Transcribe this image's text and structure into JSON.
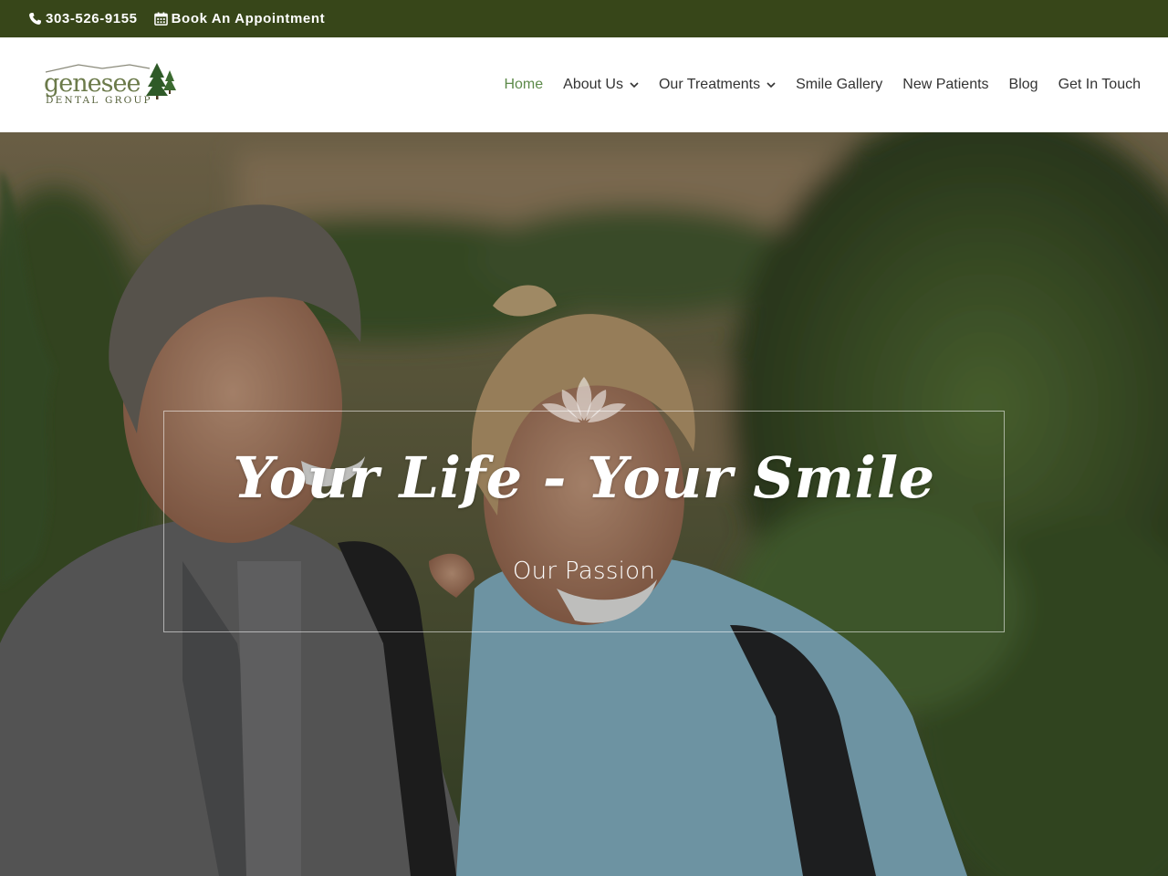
{
  "topbar": {
    "phone": "303-526-9155",
    "phone_icon": "phone-icon",
    "appointment": "Book An Appointment",
    "appointment_icon": "calendar-icon",
    "bg_color": "#374619"
  },
  "header": {
    "logo_alt": "Genesee Dental Group",
    "nav": [
      {
        "label": "Home",
        "active": true,
        "has_dropdown": false
      },
      {
        "label": "About Us",
        "active": false,
        "has_dropdown": true
      },
      {
        "label": "Our Treatments",
        "active": false,
        "has_dropdown": true
      },
      {
        "label": "Smile Gallery",
        "active": false,
        "has_dropdown": false
      },
      {
        "label": "New Patients",
        "active": false,
        "has_dropdown": false
      },
      {
        "label": "Blog",
        "active": false,
        "has_dropdown": false
      },
      {
        "label": "Get In Touch",
        "active": false,
        "has_dropdown": false
      }
    ],
    "active_color": "#5d8a4a"
  },
  "hero": {
    "title": "Your Life - Your Smile",
    "subtitle": "Our Passion",
    "ornament_icon": "lotus-icon"
  }
}
